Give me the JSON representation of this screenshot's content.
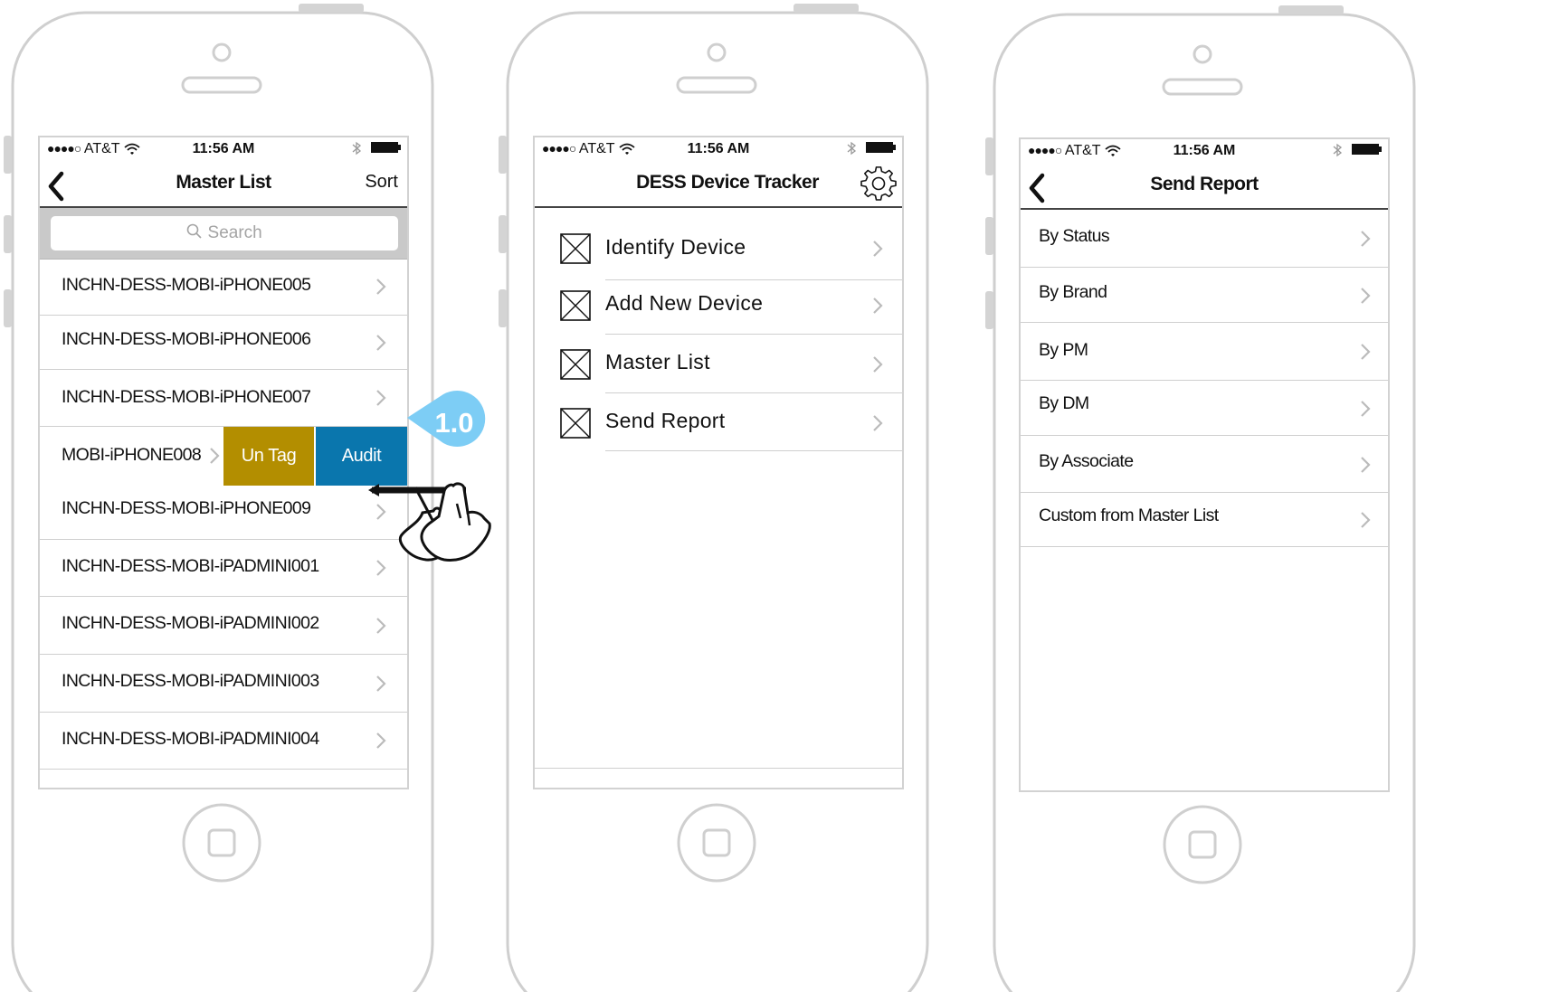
{
  "status_bar": {
    "signal": "●●●●○",
    "carrier": "AT&T",
    "time": "11:56 AM"
  },
  "phone1": {
    "title": "Master List",
    "back_icon": "chevron-left-icon",
    "sort_label": "Sort",
    "search": {
      "placeholder": "Search",
      "icon": "search-icon"
    },
    "items": [
      "INCHN-DESS-MOBI-iPHONE005",
      "INCHN-DESS-MOBI-iPHONE006",
      "INCHN-DESS-MOBI-iPHONE007",
      "MOBI-iPHONE008",
      "INCHN-DESS-MOBI-iPHONE009",
      "INCHN-DESS-MOBI-iPADMINI001",
      "INCHN-DESS-MOBI-iPADMINI002",
      "INCHN-DESS-MOBI-iPADMINI003",
      "INCHN-DESS-MOBI-iPADMINI004"
    ],
    "swipe_actions": {
      "untag": "Un Tag",
      "audit": "Audit"
    },
    "colors": {
      "untag": "#b38e00",
      "audit": "#0a76ad"
    }
  },
  "annotation": {
    "label": "1.0",
    "color": "#7dcdf5",
    "gesture_icon": "swipe-left-hand-icon"
  },
  "phone2": {
    "title": "DESS Device Tracker",
    "settings_icon": "gear-icon",
    "menu": [
      {
        "label": "Identify Device",
        "icon": "placeholder-image-icon"
      },
      {
        "label": "Add New Device",
        "icon": "placeholder-image-icon"
      },
      {
        "label": "Master List",
        "icon": "placeholder-image-icon"
      },
      {
        "label": "Send Report",
        "icon": "placeholder-image-icon"
      }
    ]
  },
  "phone3": {
    "title": "Send Report",
    "back_icon": "chevron-left-icon",
    "items": [
      "By Status",
      "By Brand",
      "By PM",
      "By DM",
      "By Associate",
      "Custom from Master List"
    ]
  }
}
